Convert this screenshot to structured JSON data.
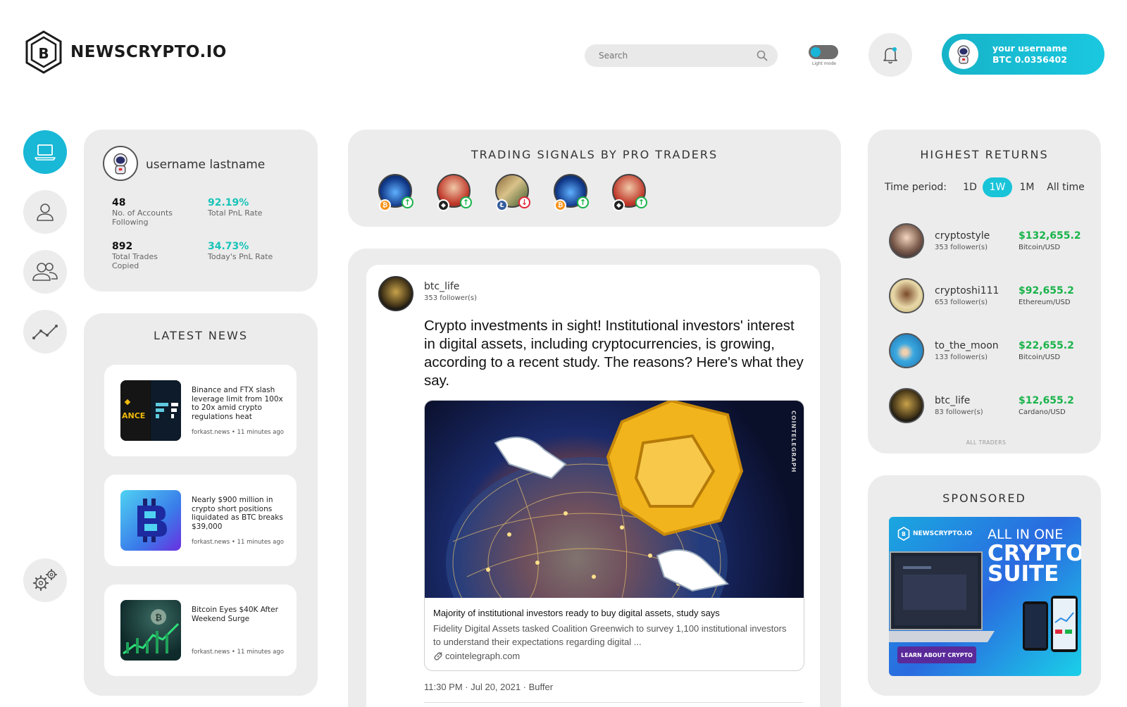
{
  "header": {
    "logo_text": "NEWSCRYPTO.IO",
    "logo_letter": "B",
    "search_placeholder": "Search",
    "toggle_label": "Light mode",
    "user_name": "your username",
    "user_balance": "BTC 0.0356402"
  },
  "profile": {
    "name": "username lastname",
    "stats": [
      {
        "value": "48",
        "label": "No. of Accounts Following"
      },
      {
        "value": "92.19%",
        "label": "Total PnL Rate"
      },
      {
        "value": "892",
        "label": "Total Trades Copied"
      },
      {
        "value": "34.73%",
        "label": "Today's PnL Rate"
      }
    ]
  },
  "news": {
    "title": "LATEST NEWS",
    "items": [
      {
        "text": "Binance and FTX slash leverage limit from 100x to 20x amid crypto regulations heat",
        "source": "forkast.news • 11 minutes ago",
        "thumb_text": "ANCE"
      },
      {
        "text": "Nearly $900 million in crypto short positions liquidated as BTC breaks $39,000",
        "source": "forkast.news • 11 minutes ago"
      },
      {
        "text": "Bitcoin Eyes $40K After Weekend Surge",
        "source": "forkast.news • 11 minutes ago"
      }
    ]
  },
  "signals": {
    "title": "TRADING SIGNALS BY PRO TRADERS",
    "items": [
      {
        "coin": "btc",
        "coin_glyph": "₿",
        "direction": "up",
        "arrow": "↑"
      },
      {
        "coin": "eth",
        "coin_glyph": "◆",
        "direction": "up",
        "arrow": "↑"
      },
      {
        "coin": "ltc",
        "coin_glyph": "Ł",
        "direction": "down",
        "arrow": "↓"
      },
      {
        "coin": "btc",
        "coin_glyph": "₿",
        "direction": "up",
        "arrow": "↑"
      },
      {
        "coin": "eth",
        "coin_glyph": "◆",
        "direction": "up",
        "arrow": "↑"
      }
    ]
  },
  "post": {
    "author": "btc_life",
    "followers": "353 follower(s)",
    "text": "Crypto investments in sight! Institutional investors' interest in digital assets, including cryptocurrencies, is growing, according to a recent study. The reasons? Here's what they say.",
    "image_watermark": "COINTELEGRAPH",
    "link_title": "Majority of institutional investors ready to buy digital assets, study says",
    "link_desc": "Fidelity Digital Assets tasked Coalition Greenwich to survey 1,100 institutional investors to understand their expectations regarding digital ...",
    "link_url": "cointelegraph.com",
    "timestamp": "11:30 PM · Jul 20, 2021 · Buffer"
  },
  "returns": {
    "title": "HIGHEST RETURNS",
    "time_label": "Time period:",
    "periods": [
      "1D",
      "1W",
      "1M",
      "All time"
    ],
    "active_period": "1W",
    "traders": [
      {
        "name": "cryptostyle",
        "followers": "353 follower(s)",
        "return": "$132,655.2",
        "pair": "Bitcoin/USD"
      },
      {
        "name": "cryptoshi111",
        "followers": "653 follower(s)",
        "return": "$92,655.2",
        "pair": "Ethereum/USD"
      },
      {
        "name": "to_the_moon",
        "followers": "133 follower(s)",
        "return": "$22,655.2",
        "pair": "Bitcoin/USD"
      },
      {
        "name": "btc_life",
        "followers": "83 follower(s)",
        "return": "$12,655.2",
        "pair": "Cardano/USD"
      }
    ],
    "all_traders": "ALL TRADERS"
  },
  "sponsored": {
    "title": "SPONSORED",
    "ad_logo": "NEWSCRYPTO.IO",
    "ad_line1": "ALL IN ONE",
    "ad_line2": "CRYPTO",
    "ad_line3": "SUITE",
    "ad_button": "LEARN ABOUT CRYPTO"
  },
  "colors": {
    "accent": "#18b8d6",
    "positive": "#19b34a",
    "pnl": "#17c4b8",
    "negative": "#e0283a"
  }
}
